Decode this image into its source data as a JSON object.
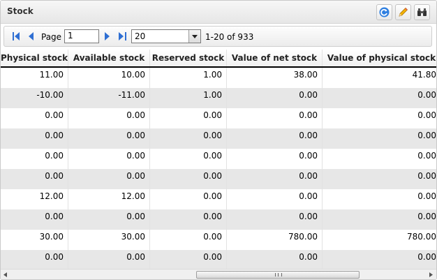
{
  "panel": {
    "title": "Stock"
  },
  "toolbar": [
    {
      "name": "refresh-button",
      "icon": "refresh-icon"
    },
    {
      "name": "edit-button",
      "icon": "pencil-icon"
    },
    {
      "name": "search-button",
      "icon": "binoculars-icon"
    }
  ],
  "pager": {
    "page_label": "Page",
    "page_value": "1",
    "page_size": "20",
    "range_text": "1-20 of 933"
  },
  "grid": {
    "columns": [
      "Physical stock",
      "Available stock",
      "Reserved stock",
      "Value of net stock",
      "Value of physical stock"
    ],
    "rows": [
      [
        "11.00",
        "10.00",
        "1.00",
        "38.00",
        "41.80"
      ],
      [
        "-10.00",
        "-11.00",
        "1.00",
        "0.00",
        "0.00"
      ],
      [
        "0.00",
        "0.00",
        "0.00",
        "0.00",
        "0.00"
      ],
      [
        "0.00",
        "0.00",
        "0.00",
        "0.00",
        "0.00"
      ],
      [
        "0.00",
        "0.00",
        "0.00",
        "0.00",
        "0.00"
      ],
      [
        "0.00",
        "0.00",
        "0.00",
        "0.00",
        "0.00"
      ],
      [
        "12.00",
        "12.00",
        "0.00",
        "0.00",
        "0.00"
      ],
      [
        "0.00",
        "0.00",
        "0.00",
        "0.00",
        "0.00"
      ],
      [
        "30.00",
        "30.00",
        "0.00",
        "780.00",
        "780.00"
      ],
      [
        "0.00",
        "0.00",
        "0.00",
        "0.00",
        "0.00"
      ]
    ]
  },
  "colors": {
    "alt_row": "#e7e7e7",
    "accent_blue": "#2f6fd3"
  }
}
